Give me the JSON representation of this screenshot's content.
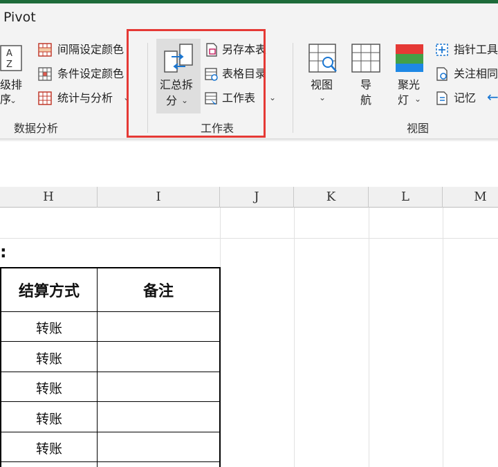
{
  "ribbon": {
    "tab_name": "Pivot",
    "sort_button": {
      "top": "A\nZ",
      "label_line1": "级排",
      "label_line2": "序"
    },
    "data_analysis_group": {
      "items": [
        "间隔设定颜色",
        "条件设定颜色",
        "统计与分析"
      ],
      "label": "数据分析"
    },
    "worksheet_group": {
      "big_button_line1": "汇总拆",
      "big_button_line2": "分",
      "items": [
        "另存本表",
        "表格目录",
        "工作表"
      ],
      "label": "工作表"
    },
    "view_group": {
      "buttons": [
        {
          "line1": "视图",
          "line2": ""
        },
        {
          "line1": "导",
          "line2": "航"
        },
        {
          "line1": "聚光",
          "line2": "灯"
        }
      ],
      "right_items": [
        "指针工具",
        "关注相同",
        "记忆"
      ],
      "label": "视图"
    }
  },
  "sheet": {
    "columns": [
      "H",
      "I",
      "J",
      "K",
      "L",
      "M"
    ],
    "colon_text": ":",
    "table": {
      "headers": [
        "结算方式",
        "备注"
      ],
      "rows": [
        [
          "转账",
          ""
        ],
        [
          "转账",
          ""
        ],
        [
          "转账",
          ""
        ],
        [
          "转账",
          ""
        ],
        [
          "转账",
          ""
        ]
      ]
    }
  },
  "colors": {
    "title_bar_green": "#1e6b3a",
    "highlight_red": "#e53935",
    "ribbon_background": "#f3f3f3"
  }
}
